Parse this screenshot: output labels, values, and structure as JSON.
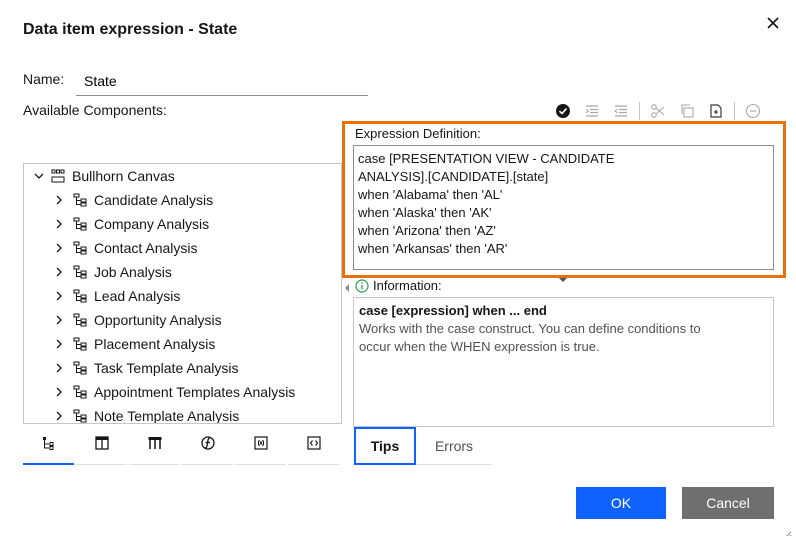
{
  "dialog": {
    "title": "Data item expression - State",
    "close_icon": "close-icon"
  },
  "name": {
    "label": "Name:",
    "value": "State"
  },
  "available_components": {
    "label": "Available Components:",
    "tree": {
      "root": {
        "label": "Bullhorn Canvas",
        "icon": "package-icon",
        "expanded": true
      },
      "items": [
        {
          "label": "Candidate Analysis",
          "icon": "hierarchy-icon"
        },
        {
          "label": "Company Analysis",
          "icon": "hierarchy-icon"
        },
        {
          "label": "Contact Analysis",
          "icon": "hierarchy-icon"
        },
        {
          "label": "Job Analysis",
          "icon": "hierarchy-icon"
        },
        {
          "label": "Lead Analysis",
          "icon": "hierarchy-icon"
        },
        {
          "label": "Opportunity Analysis",
          "icon": "hierarchy-icon"
        },
        {
          "label": "Placement Analysis",
          "icon": "hierarchy-icon"
        },
        {
          "label": "Task Template Analysis",
          "icon": "hierarchy-icon"
        },
        {
          "label": "Appointment Templates Analysis",
          "icon": "hierarchy-icon"
        },
        {
          "label": "Note Template Analysis",
          "icon": "hierarchy-icon"
        }
      ]
    },
    "tabs": [
      {
        "name": "source-tab",
        "icon": "tree-view-icon",
        "active": true
      },
      {
        "name": "data-items-tab",
        "icon": "table-column-icon",
        "active": false
      },
      {
        "name": "queries-tab",
        "icon": "query-table-icon",
        "active": false
      },
      {
        "name": "functions-tab",
        "icon": "function-icon",
        "active": false
      },
      {
        "name": "parameters-tab",
        "icon": "parameter-icon",
        "active": false
      },
      {
        "name": "macros-tab",
        "icon": "code-icon",
        "active": false
      }
    ]
  },
  "toolbar": {
    "icons": [
      "validate-check-icon",
      "indent-icon",
      "outdent-icon",
      "cut-icon",
      "copy-icon",
      "paste-icon",
      "remove-icon"
    ]
  },
  "expression": {
    "label": "Expression Definition:",
    "lines": [
      "case [PRESENTATION VIEW - CANDIDATE",
      "ANALYSIS].[CANDIDATE].[state]",
      "when 'Alabama' then 'AL'",
      "when 'Alaska' then 'AK'",
      "when 'Arizona' then 'AZ'",
      "when 'Arkansas' then 'AR'"
    ]
  },
  "information": {
    "label": "Information:",
    "title": "case [expression] when ... end",
    "body_lines": [
      "Works with the case construct. You can define conditions to",
      "occur when the WHEN expression is true."
    ]
  },
  "bottom_tabs": {
    "tips": "Tips",
    "errors": "Errors",
    "active": "tips"
  },
  "buttons": {
    "ok": "OK",
    "cancel": "Cancel"
  },
  "colors": {
    "primary": "#0f62fe",
    "secondary": "#6f6f6f",
    "highlight": "#e8710a"
  }
}
